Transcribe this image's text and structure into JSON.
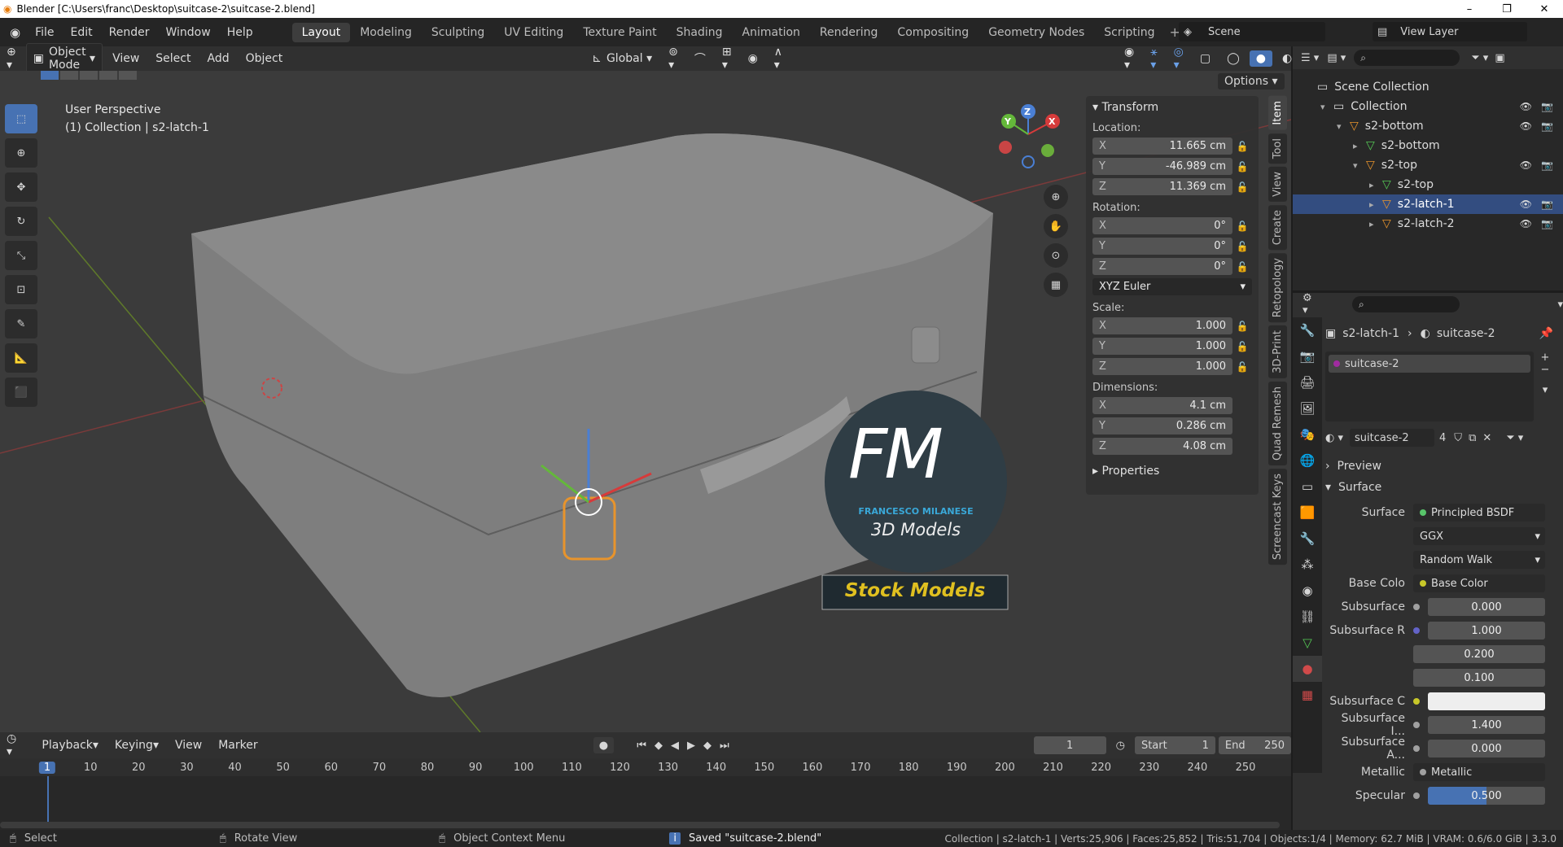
{
  "window": {
    "title": "Blender [C:\\Users\\franc\\Desktop\\suitcase-2\\suitcase-2.blend]",
    "minimize": "–",
    "maximize": "❐",
    "close": "✕"
  },
  "menu": [
    "File",
    "Edit",
    "Render",
    "Window",
    "Help"
  ],
  "workspaces": [
    "Layout",
    "Modeling",
    "Sculpting",
    "UV Editing",
    "Texture Paint",
    "Shading",
    "Animation",
    "Rendering",
    "Compositing",
    "Geometry Nodes",
    "Scripting"
  ],
  "add_workspace": "+",
  "scene": {
    "label": "Scene",
    "view_layer": "View Layer"
  },
  "viewport_header": {
    "mode": "Object Mode",
    "menus": [
      "View",
      "Select",
      "Add",
      "Object"
    ],
    "transform_orientation": "Global",
    "options": "Options"
  },
  "viewport": {
    "perspective": "User Perspective",
    "collection_info": "(1) Collection | s2-latch-1"
  },
  "gizmo": {
    "x": "X",
    "y": "Y",
    "z": "Z"
  },
  "watermark": {
    "letters": "FM",
    "name": "FRANCESCO MILANESE",
    "sub": "3D Models",
    "banner": "Stock Models"
  },
  "npanel": {
    "header": "Transform",
    "location_label": "Location:",
    "location": [
      {
        "axis": "X",
        "value": "11.665 cm"
      },
      {
        "axis": "Y",
        "value": "-46.989 cm"
      },
      {
        "axis": "Z",
        "value": "11.369 cm"
      }
    ],
    "rotation_label": "Rotation:",
    "rotation": [
      {
        "axis": "X",
        "value": "0°"
      },
      {
        "axis": "Y",
        "value": "0°"
      },
      {
        "axis": "Z",
        "value": "0°"
      }
    ],
    "rotation_mode": "XYZ Euler",
    "scale_label": "Scale:",
    "scale": [
      {
        "axis": "X",
        "value": "1.000"
      },
      {
        "axis": "Y",
        "value": "1.000"
      },
      {
        "axis": "Z",
        "value": "1.000"
      }
    ],
    "dimensions_label": "Dimensions:",
    "dimensions": [
      {
        "axis": "X",
        "value": "4.1 cm"
      },
      {
        "axis": "Y",
        "value": "0.286 cm"
      },
      {
        "axis": "Z",
        "value": "4.08 cm"
      }
    ],
    "properties": "Properties"
  },
  "side_tabs": [
    "Item",
    "Tool",
    "View",
    "Create",
    "Retopology",
    "3D-Print",
    "Quad Remesh",
    "Screencast Keys"
  ],
  "outliner": {
    "rows": [
      {
        "label": "Scene Collection",
        "depth": 0
      },
      {
        "label": "Collection",
        "depth": 1
      },
      {
        "label": "s2-bottom",
        "depth": 2
      },
      {
        "label": "s2-bottom",
        "depth": 3
      },
      {
        "label": "s2-top",
        "depth": 3
      },
      {
        "label": "s2-top",
        "depth": 4
      },
      {
        "label": "s2-latch-1",
        "depth": 4
      },
      {
        "label": "s2-latch-2",
        "depth": 4
      }
    ]
  },
  "properties": {
    "breadcrumb_object": "s2-latch-1",
    "breadcrumb_material": "suitcase-2",
    "material_slot": "suitcase-2",
    "material_name": "suitcase-2",
    "material_users": "4",
    "preview": "Preview",
    "surface_section": "Surface",
    "rows": [
      {
        "label": "Surface",
        "value": "Principled BSDF",
        "kind": "node",
        "dot": "#58c46a"
      },
      {
        "label": "",
        "value": "GGX",
        "kind": "drop"
      },
      {
        "label": "",
        "value": "Random Walk",
        "kind": "drop"
      },
      {
        "label": "Base Colo",
        "value": "Base Color",
        "kind": "node",
        "dot": "#c7c729"
      },
      {
        "label": "Subsurface",
        "value": "0.000",
        "kind": "val",
        "dot": "#a0a0a0"
      },
      {
        "label": "Subsurface R",
        "value": "1.000",
        "kind": "val",
        "dot": "#6363c7"
      },
      {
        "label": "",
        "value": "0.200",
        "kind": "val"
      },
      {
        "label": "",
        "value": "0.100",
        "kind": "val"
      },
      {
        "label": "Subsurface C",
        "value": "",
        "kind": "white",
        "dot": "#c7c729"
      },
      {
        "label": "Subsurface I...",
        "value": "1.400",
        "kind": "val",
        "dot": "#a0a0a0"
      },
      {
        "label": "Subsurface A...",
        "value": "0.000",
        "kind": "val",
        "dot": "#a0a0a0"
      },
      {
        "label": "Metallic",
        "value": "Metallic",
        "kind": "node",
        "dot": "#a0a0a0"
      },
      {
        "label": "Specular",
        "value": "0.500",
        "kind": "blue",
        "dot": "#a0a0a0"
      }
    ]
  },
  "timeline": {
    "menus": [
      "Playback",
      "Keying",
      "View",
      "Marker"
    ],
    "current_frame": "1",
    "start_label": "Start",
    "start": "1",
    "end_label": "End",
    "end": "250",
    "frames": [
      "1",
      "10",
      "20",
      "30",
      "40",
      "50",
      "60",
      "70",
      "80",
      "90",
      "100",
      "110",
      "120",
      "130",
      "140",
      "150",
      "160",
      "170",
      "180",
      "190",
      "200",
      "210",
      "220",
      "230",
      "240",
      "250"
    ]
  },
  "statusbar": {
    "select": "Select",
    "rotate": "Rotate View",
    "context": "Object Context Menu",
    "saved": "Saved \"suitcase-2.blend\"",
    "stats": "Collection | s2-latch-1 | Verts:25,906 | Faces:25,852 | Tris:51,704 | Objects:1/4 | Memory: 62.7 MiB | VRAM: 0.6/6.0 GiB | 3.3.0"
  }
}
